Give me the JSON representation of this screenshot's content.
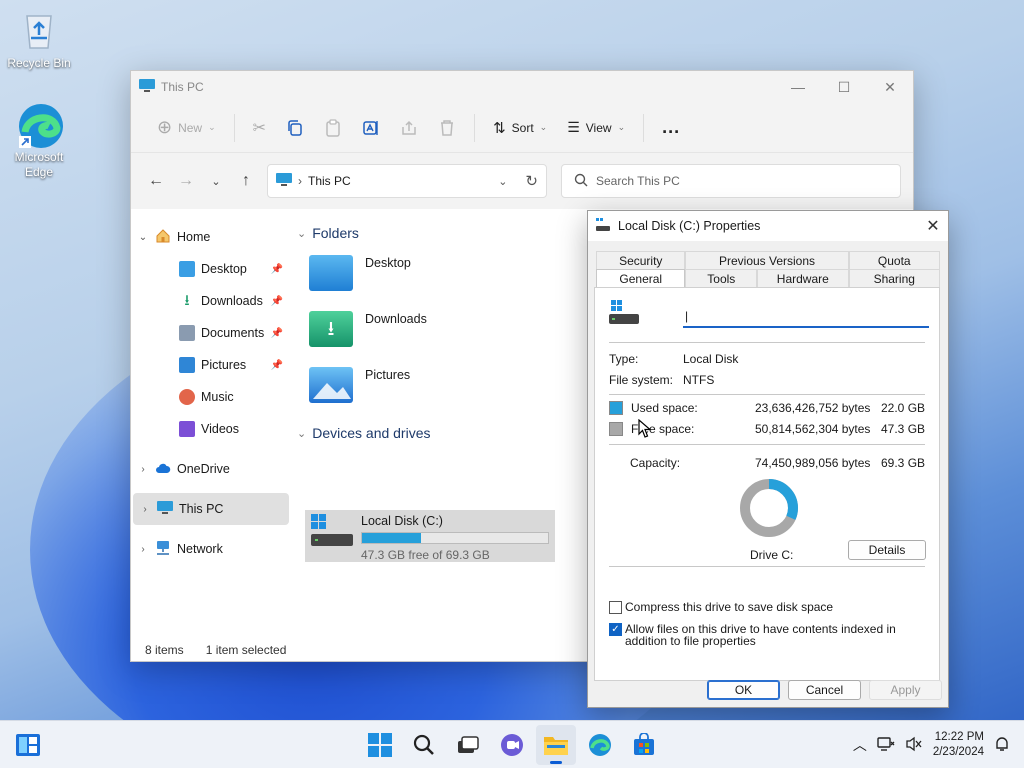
{
  "desktop": {
    "icons": [
      {
        "label": "Recycle Bin"
      },
      {
        "label": "Microsoft Edge"
      }
    ]
  },
  "explorer": {
    "title": "This PC",
    "toolbar": {
      "new_label": "New",
      "sort_label": "Sort",
      "view_label": "View",
      "more_label": "..."
    },
    "address": "This PC",
    "search_placeholder": "Search This PC",
    "sidebar": [
      {
        "label": "Home"
      },
      {
        "label": "Desktop"
      },
      {
        "label": "Downloads"
      },
      {
        "label": "Documents"
      },
      {
        "label": "Pictures"
      },
      {
        "label": "Music"
      },
      {
        "label": "Videos"
      },
      {
        "label": "OneDrive"
      },
      {
        "label": "This PC"
      },
      {
        "label": "Network"
      }
    ],
    "sections": {
      "folders": "Folders",
      "devices": "Devices and drives"
    },
    "folders": [
      {
        "name": "Desktop"
      },
      {
        "name": "Downloads"
      },
      {
        "name": "Pictures"
      }
    ],
    "drive": {
      "name": "Local Disk (C:)",
      "free_text": "47.3 GB free of 69.3 GB",
      "used_fraction": 0.317
    },
    "status": {
      "items": "8 items",
      "selected": "1 item selected"
    }
  },
  "properties": {
    "title": "Local Disk (C:) Properties",
    "tabs_top": [
      "Security",
      "Previous Versions",
      "Quota"
    ],
    "tabs_bottom": [
      "General",
      "Tools",
      "Hardware",
      "Sharing"
    ],
    "name_value": "",
    "type_label": "Type:",
    "type_value": "Local Disk",
    "fs_label": "File system:",
    "fs_value": "NTFS",
    "used_label": "Used space:",
    "used_bytes": "23,636,426,752 bytes",
    "used_gb": "22.0 GB",
    "free_label": "Free space:",
    "free_bytes": "50,814,562,304 bytes",
    "free_gb": "47.3 GB",
    "cap_label": "Capacity:",
    "cap_bytes": "74,450,989,056 bytes",
    "cap_gb": "69.3 GB",
    "drive_label": "Drive C:",
    "details_label": "Details",
    "compress_label": "Compress this drive to save disk space",
    "compress_checked": false,
    "index_label": "Allow files on this drive to have contents indexed in addition to file properties",
    "index_checked": true,
    "ok_label": "OK",
    "cancel_label": "Cancel",
    "apply_label": "Apply",
    "used_color": "#26a0da",
    "free_color": "#a8a8a8"
  },
  "taskbar": {
    "time": "12:22 PM",
    "date": "2/23/2024"
  }
}
